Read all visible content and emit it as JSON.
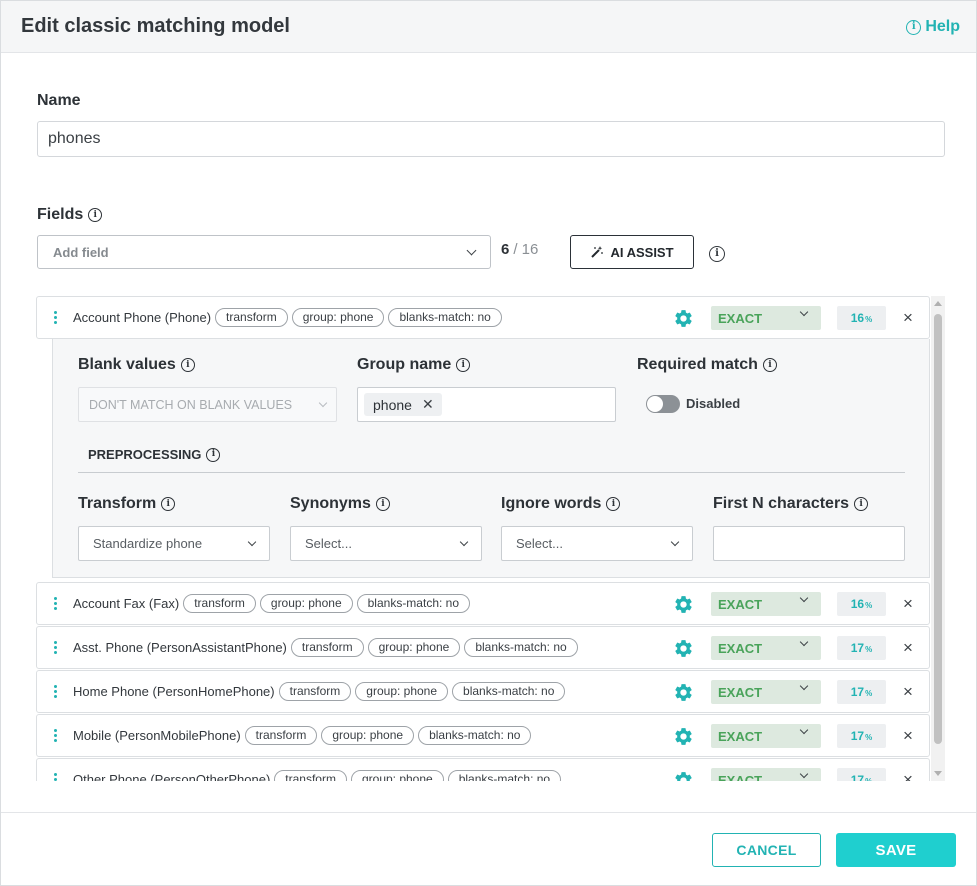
{
  "header": {
    "title": "Edit classic matching model",
    "help_label": "Help"
  },
  "name_section": {
    "label": "Name",
    "value": "phones"
  },
  "fields_section": {
    "label": "Fields",
    "add_field_placeholder": "Add field",
    "count": "6",
    "max": "/ 16",
    "ai_assist_label": "AI ASSIST"
  },
  "fields": [
    {
      "name": "Account Phone (Phone)",
      "tags": [
        "transform",
        "group: phone",
        "blanks-match: no"
      ],
      "match_type": "EXACT",
      "weight": "16",
      "weight_unit": "%"
    },
    {
      "name": "Account Fax (Fax)",
      "tags": [
        "transform",
        "group: phone",
        "blanks-match: no"
      ],
      "match_type": "EXACT",
      "weight": "16",
      "weight_unit": "%"
    },
    {
      "name": "Asst. Phone (PersonAssistantPhone)",
      "tags": [
        "transform",
        "group: phone",
        "blanks-match: no"
      ],
      "match_type": "EXACT",
      "weight": "17",
      "weight_unit": "%"
    },
    {
      "name": "Home Phone (PersonHomePhone)",
      "tags": [
        "transform",
        "group: phone",
        "blanks-match: no"
      ],
      "match_type": "EXACT",
      "weight": "17",
      "weight_unit": "%"
    },
    {
      "name": "Mobile (PersonMobilePhone)",
      "tags": [
        "transform",
        "group: phone",
        "blanks-match: no"
      ],
      "match_type": "EXACT",
      "weight": "17",
      "weight_unit": "%"
    },
    {
      "name": "Other Phone (PersonOtherPhone)",
      "tags": [
        "transform",
        "group: phone",
        "blanks-match: no"
      ],
      "match_type": "EXACT",
      "weight": "17",
      "weight_unit": "%"
    }
  ],
  "details": {
    "blank_values_label": "Blank values",
    "blank_values_value": "DON'T MATCH ON BLANK VALUES",
    "group_name_label": "Group name",
    "group_name_chip": "phone",
    "required_match_label": "Required match",
    "required_match_state": "Disabled",
    "preprocessing_label": "PREPROCESSING",
    "transform_label": "Transform",
    "transform_value": "Standardize phone",
    "synonyms_label": "Synonyms",
    "synonyms_placeholder": "Select...",
    "ignore_words_label": "Ignore words",
    "ignore_words_placeholder": "Select...",
    "first_n_label": "First N characters",
    "first_n_value": ""
  },
  "footer": {
    "cancel_label": "CANCEL",
    "save_label": "SAVE"
  },
  "colors": {
    "accent": "#22b3b3",
    "save": "#1fcfcf",
    "exact_bg": "#dde9df",
    "exact_text": "#49a35a"
  },
  "icons": {
    "help": "info-icon",
    "ai": "magic-wand-icon",
    "settings": "gear-icon",
    "remove": "close-icon",
    "drag": "drag-handle-icon"
  }
}
